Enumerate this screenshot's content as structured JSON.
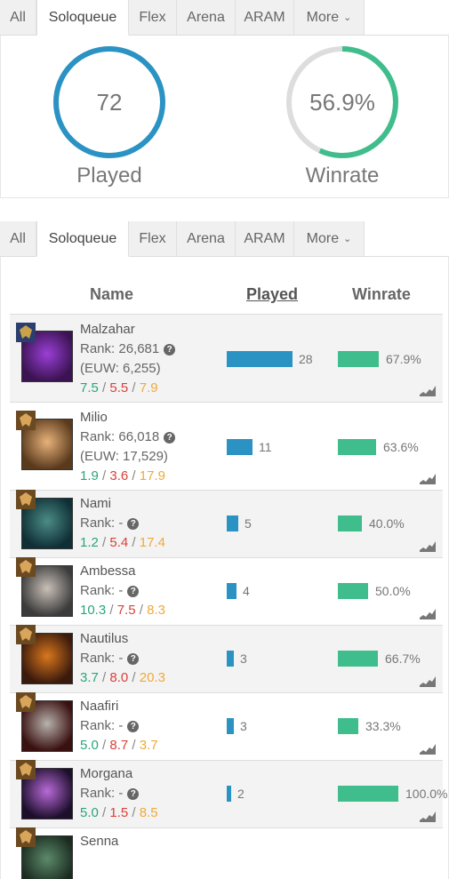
{
  "queue_tabs_top": {
    "tabs": [
      {
        "label": "All"
      },
      {
        "label": "Soloqueue"
      },
      {
        "label": "Flex"
      },
      {
        "label": "Arena"
      },
      {
        "label": "ARAM"
      },
      {
        "label": "More"
      }
    ],
    "active": "Soloqueue"
  },
  "summary": {
    "played": {
      "value": "72",
      "label": "Played",
      "fill": 1.0,
      "color": "#2b93c4"
    },
    "winrate": {
      "value": "56.9%",
      "label": "Winrate",
      "fill": 0.569,
      "color": "#40bd8c",
      "track": "#dddddd"
    }
  },
  "queue_tabs_bottom": {
    "tabs": [
      {
        "label": "All"
      },
      {
        "label": "Soloqueue"
      },
      {
        "label": "Flex"
      },
      {
        "label": "Arena"
      },
      {
        "label": "ARAM"
      },
      {
        "label": "More"
      }
    ],
    "active": "Soloqueue"
  },
  "table": {
    "headers": {
      "name": "Name",
      "played": "Played",
      "winrate": "Winrate"
    },
    "rows": [
      {
        "champion": "Malzahar",
        "rank": "Rank: 26,681",
        "euw": "(EUW: 6,255)",
        "kills": "7.5",
        "deaths": "5.5",
        "assists": "7.9",
        "played": "28",
        "played_value": 28,
        "winrate": "67.9%",
        "winrate_value": 67.9,
        "badge": "emerald",
        "colors": [
          "#3b1352",
          "#9a3fd6"
        ]
      },
      {
        "champion": "Milio",
        "rank": "Rank: 66,018",
        "euw": "(EUW: 17,529)",
        "kills": "1.9",
        "deaths": "3.6",
        "assists": "17.9",
        "played": "11",
        "played_value": 11,
        "winrate": "63.6%",
        "winrate_value": 63.6,
        "badge": "bronze",
        "colors": [
          "#5a3a1c",
          "#e7b27b"
        ]
      },
      {
        "champion": "Nami",
        "rank": "Rank: -",
        "euw": "",
        "kills": "1.2",
        "deaths": "5.4",
        "assists": "17.4",
        "played": "5",
        "played_value": 5,
        "winrate": "40.0%",
        "winrate_value": 40.0,
        "badge": "bronze",
        "colors": [
          "#0f2f36",
          "#4c8c86"
        ]
      },
      {
        "champion": "Ambessa",
        "rank": "Rank: -",
        "euw": "",
        "kills": "10.3",
        "deaths": "7.5",
        "assists": "8.3",
        "played": "4",
        "played_value": 4,
        "winrate": "50.0%",
        "winrate_value": 50.0,
        "badge": "bronze",
        "colors": [
          "#3b3b3b",
          "#c9c0b8"
        ]
      },
      {
        "champion": "Nautilus",
        "rank": "Rank: -",
        "euw": "",
        "kills": "3.7",
        "deaths": "8.0",
        "assists": "20.3",
        "played": "3",
        "played_value": 3,
        "winrate": "66.7%",
        "winrate_value": 66.7,
        "badge": "bronze",
        "colors": [
          "#3a1a0c",
          "#d9771e"
        ]
      },
      {
        "champion": "Naafiri",
        "rank": "Rank: -",
        "euw": "",
        "kills": "5.0",
        "deaths": "8.7",
        "assists": "3.7",
        "played": "3",
        "played_value": 3,
        "winrate": "33.3%",
        "winrate_value": 33.3,
        "badge": "bronze",
        "colors": [
          "#3a1010",
          "#b7b2ad"
        ]
      },
      {
        "champion": "Morgana",
        "rank": "Rank: -",
        "euw": "",
        "kills": "5.0",
        "deaths": "1.5",
        "assists": "8.5",
        "played": "2",
        "played_value": 2,
        "winrate": "100.0%",
        "winrate_value": 100.0,
        "badge": "bronze",
        "colors": [
          "#1d0f2c",
          "#b86ad8"
        ]
      },
      {
        "champion": "Senna",
        "rank": "",
        "euw": "",
        "kills": "",
        "deaths": "",
        "assists": "",
        "played": "",
        "played_value": 0,
        "winrate": "",
        "winrate_value": 0,
        "badge": "bronze",
        "colors": [
          "#1b2b20",
          "#5c8a6a"
        ]
      }
    ]
  }
}
